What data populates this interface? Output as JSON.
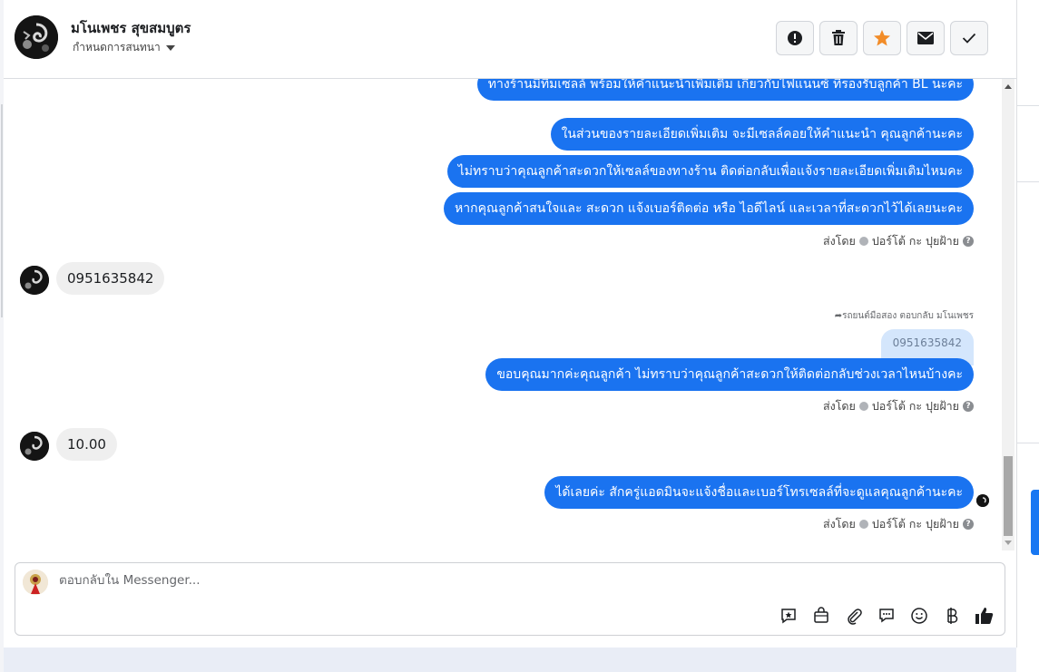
{
  "header": {
    "contact_name": "มโนเพชร สุขสมบูตร",
    "assign_label": "กำหนดการสนทนา"
  },
  "actions": [
    {
      "name": "alert-icon"
    },
    {
      "name": "trash-icon"
    },
    {
      "name": "star-icon",
      "color": "#f28c28"
    },
    {
      "name": "envelope-icon"
    },
    {
      "name": "check-icon"
    }
  ],
  "messages": {
    "out_1": "ทางร้านมีทีมเซลล์ พร้อมให้คำแนะนำเพิ่มเติม เกี่ยวกับไฟแนนซ์ ที่รองรับลูกค้า BL นะคะ",
    "out_2": "ในส่วนของรายละเอียดเพิ่มเติม จะมีเซลล์คอยให้คำแนะนำ คุณลูกค้านะคะ",
    "out_3": "ไม่ทราบว่าคุณลูกค้าสะดวกให้เซลล์ของทางร้าน ติดต่อกลับเพื่อแจ้งรายละเอียดเพิ่มเติมไหมคะ",
    "out_4": "หากคุณลูกค้าสนใจและ สะดวก แจ้งเบอร์ติดต่อ หรือ ไอดีไลน์ และเวลาที่สะดวกไว้ได้เลยนะคะ",
    "in_1": "0951635842",
    "reply_note": "รถยนต์มือสอง ตอบกลับ มโนเพชร",
    "quoted": "0951635842",
    "out_5": "ขอบคุณมากค่ะคุณลูกค้า ไม่ทราบว่าคุณลูกค้าสะดวกให้ติดต่อกลับช่วงเวลาไหนบ้างคะ",
    "in_2": "10.00",
    "out_6": "ได้เลยค่ะ สักครู่แอดมินจะแจ้งชื่อและเบอร์โทรเซลล์ที่จะดูแลคุณลูกค้านะคะ"
  },
  "sent_by": {
    "prefix": "ส่งโดย",
    "agent": "ปอร์โต้ กะ ปุยฝ้าย"
  },
  "composer": {
    "placeholder": "ตอบกลับใน Messenger...",
    "tools": [
      "saved-reply-icon",
      "shop-icon",
      "attachment-icon",
      "chat-icon",
      "emoji-icon",
      "baht-icon",
      "thumbs-up-icon"
    ]
  },
  "colors": {
    "outgoing_bubble": "#1a73f0",
    "incoming_bubble": "#efefef",
    "accent_star": "#f28c28"
  }
}
